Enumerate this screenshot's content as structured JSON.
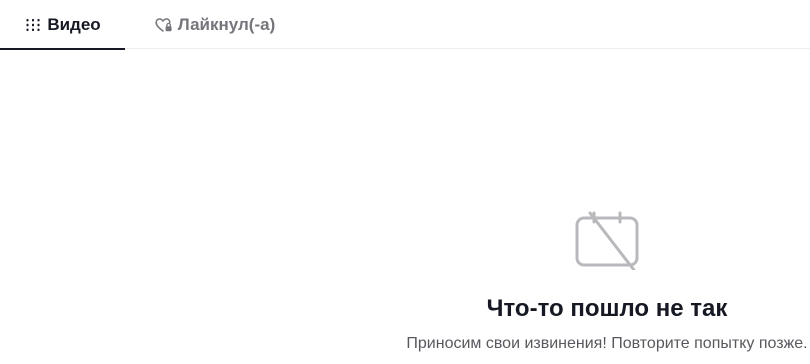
{
  "tabs": [
    {
      "label": "Видео",
      "icon": "grid-lines-icon",
      "active": true
    },
    {
      "label": "Лайкнул(-а)",
      "icon": "heart-lock-icon",
      "active": false
    }
  ],
  "empty_state": {
    "icon": "calendar-slash-icon",
    "title": "Что-то пошло не так",
    "subtitle": "Приносим свои извинения! Повторите попытку позже."
  },
  "colors": {
    "text_primary": "#161823",
    "text_secondary": "#75757b",
    "icon_gray": "#b8b8bd",
    "divider": "#eeeeef"
  }
}
